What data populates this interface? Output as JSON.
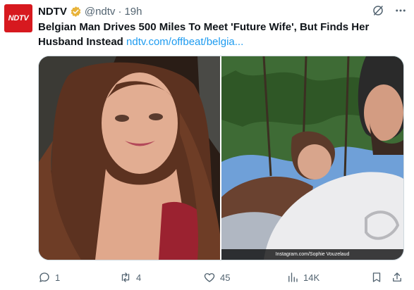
{
  "tweet": {
    "avatar_text": "NDTV",
    "author_name": "NDTV",
    "handle": "@ndtv",
    "separator": "·",
    "time": "19h",
    "text": "Belgian Man Drives 500 Miles To Meet 'Future Wife', But Finds Her Husband Instead",
    "link": "ndtv.com/offbeat/belgia...",
    "photo_credit": "Instagram.com/Sophie Vouzelaud"
  },
  "actions": {
    "reply_count": "1",
    "retweet_count": "4",
    "like_count": "45",
    "views_count": "14K"
  },
  "colors": {
    "brand_red": "#d7191f",
    "link_blue": "#1d9bf0",
    "verified_gold": "#e8b339",
    "muted": "#536471"
  }
}
